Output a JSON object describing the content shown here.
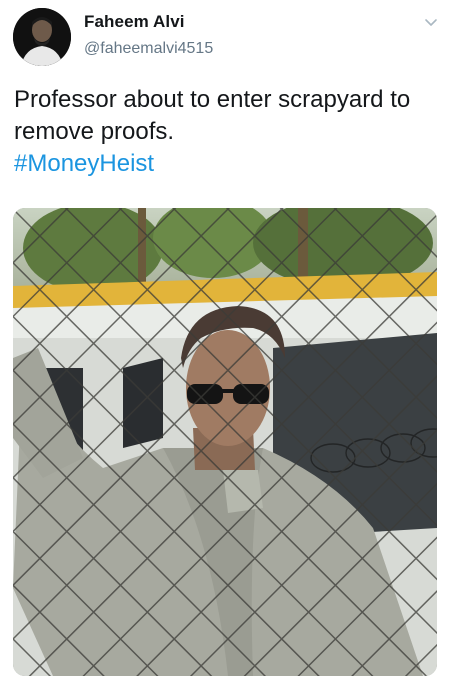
{
  "tweet": {
    "display_name": "Faheem Alvi",
    "handle": "@faheemalvi4515",
    "text": "Professor about to enter scrapyard to remove proofs.",
    "hashtag": "#MoneyHeist"
  },
  "icons": {
    "avatar": "user-avatar-icon",
    "menu": "chevron-down-icon"
  },
  "colors": {
    "name": "#14171a",
    "handle": "#657786",
    "link": "#1b95e0",
    "background": "#ffffff"
  }
}
